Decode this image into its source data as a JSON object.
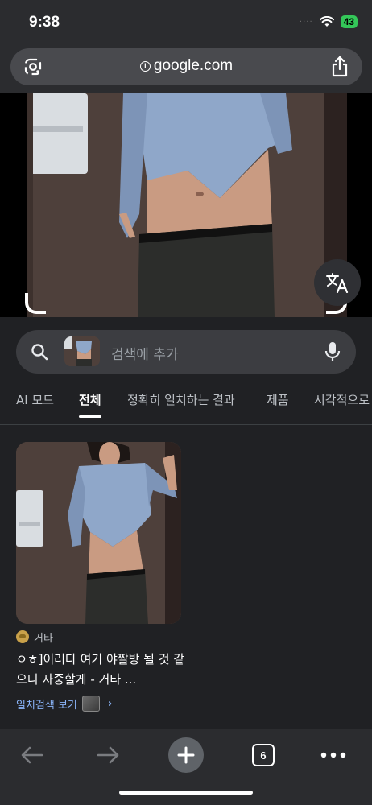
{
  "status_bar": {
    "time": "9:38",
    "signal_dots": "····",
    "wifi_icon": "wifi-icon",
    "battery": "43"
  },
  "browser": {
    "url": "google.com",
    "lens_icon": "google-lens-icon",
    "share_icon": "share-icon"
  },
  "hero_image": {
    "translate_icon": "translate-icon"
  },
  "search": {
    "placeholder": "검색에 추가",
    "search_icon": "search-icon",
    "mic_icon": "mic-icon"
  },
  "tabs": [
    {
      "label": "AI 모드",
      "active": false
    },
    {
      "label": "전체",
      "active": true
    },
    {
      "label": "정확히 일치하는 결과",
      "active": false
    },
    {
      "label": "제품",
      "active": false
    },
    {
      "label": "시각적으로",
      "active": false
    }
  ],
  "result": {
    "source": "거타",
    "title": "ㅇㅎ]이러다 여기 야짤방 될 것 같으니 자중할게 - 거타 ...",
    "match_link": "일치검색 보기",
    "chevron": "›"
  },
  "bottom_toolbar": {
    "back_icon": "back-arrow-icon",
    "forward_icon": "forward-arrow-icon",
    "new_tab_icon": "plus-icon",
    "tab_count": "6",
    "more_icon": "more-dots-icon"
  },
  "colors": {
    "background": "#202124",
    "chrome": "#2b2c2f",
    "link": "#8ab4f8",
    "battery": "#34c759"
  }
}
